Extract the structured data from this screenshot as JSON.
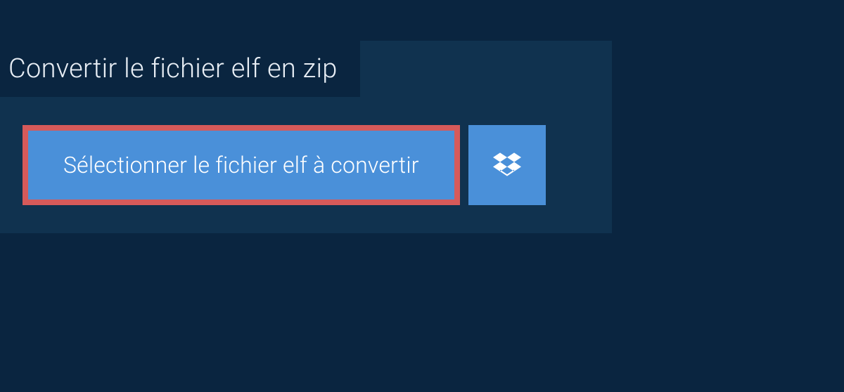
{
  "header": {
    "title": "Convertir le fichier elf en zip"
  },
  "actions": {
    "select_file_label": "Sélectionner le fichier elf à convertir"
  },
  "colors": {
    "background": "#0a2540",
    "panel": "#10324f",
    "button_primary": "#4a90d9",
    "highlight_border": "#d65a5a"
  }
}
